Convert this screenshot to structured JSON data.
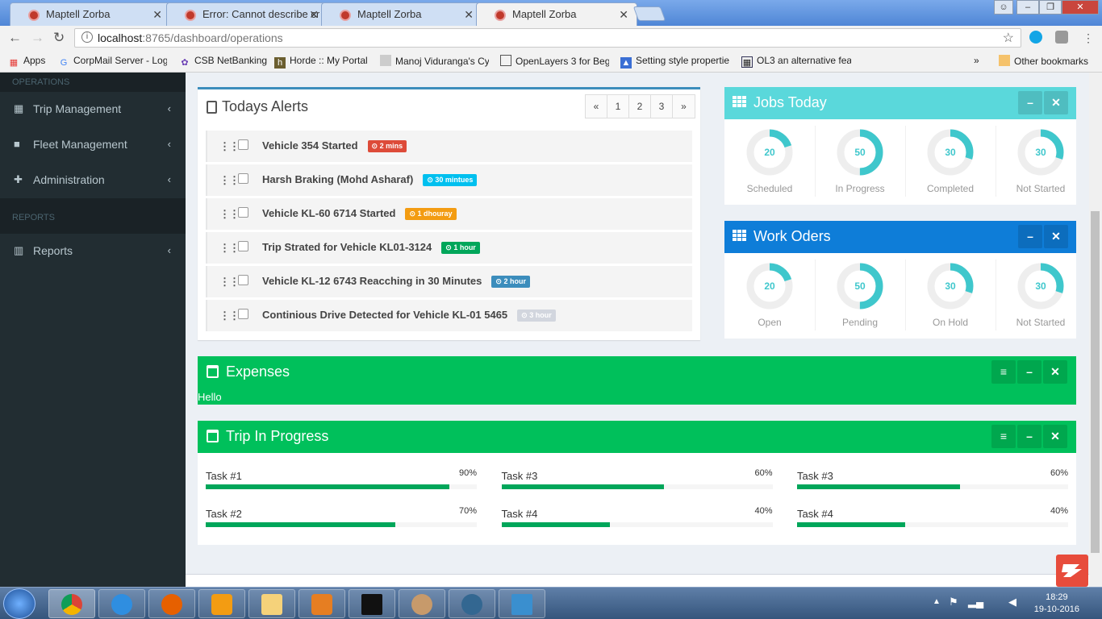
{
  "browser": {
    "tabs": [
      {
        "title": "Maptell Zorba"
      },
      {
        "title": "Error: Cannot describe cr"
      },
      {
        "title": "Maptell Zorba"
      },
      {
        "title": "Maptell Zorba"
      }
    ],
    "url_host": "localhost",
    "url_rest": ":8765/dashboard/operations",
    "bookmarks": [
      "Apps",
      "CorpMail Server - Log",
      "CSB NetBanking",
      "Horde :: My Portal",
      "Manoj Viduranga's Cy",
      "OpenLayers 3 for Beg",
      "Setting style propertie",
      "OL3 an alternative fea",
      "Other bookmarks"
    ]
  },
  "sidebar": {
    "operations_header": "OPERATIONS",
    "reports_header": "REPORTS",
    "items": [
      {
        "label": "Trip Management",
        "icon": "grid-icon"
      },
      {
        "label": "Fleet Management",
        "icon": "bus-icon"
      },
      {
        "label": "Administration",
        "icon": "puzzle-icon"
      },
      {
        "label": "Reports",
        "icon": "bar-chart-icon"
      }
    ]
  },
  "alerts": {
    "title": "Todays Alerts",
    "pager": [
      "«",
      "1",
      "2",
      "3",
      "»"
    ],
    "items": [
      {
        "text": "Vehicle 354 Started",
        "badge": "2 mins",
        "color": "#dd4b39"
      },
      {
        "text": "Harsh Braking (Mohd Asharaf)",
        "badge": "30 mintues",
        "color": "#00c0ef"
      },
      {
        "text": "Vehicle KL-60 6714 Started",
        "badge": "1 dhouray",
        "color": "#f39c12"
      },
      {
        "text": "Trip Strated for Vehicle KL01-3124",
        "badge": "1 hour",
        "color": "#00a65a"
      },
      {
        "text": "Vehicle KL-12 6743 Reacching in 30 Minutes",
        "badge": "2 hour",
        "color": "#3c8dbc"
      },
      {
        "text": "Continious Drive Detected for Vehicle KL-01 5465",
        "badge": "3 hour",
        "color": "#d2d6de"
      }
    ]
  },
  "jobs_today": {
    "title": "Jobs Today",
    "color": "#5ad8db",
    "items": [
      {
        "value": "20",
        "label": "Scheduled",
        "fraction": 0.2
      },
      {
        "value": "50",
        "label": "In Progress",
        "fraction": 0.5
      },
      {
        "value": "30",
        "label": "Completed",
        "fraction": 0.3
      },
      {
        "value": "30",
        "label": "Not Started",
        "fraction": 0.3
      }
    ]
  },
  "work_orders": {
    "title": "Work Oders",
    "color": "#0e7dd8",
    "items": [
      {
        "value": "20",
        "label": "Open",
        "fraction": 0.2
      },
      {
        "value": "50",
        "label": "Pending",
        "fraction": 0.5
      },
      {
        "value": "30",
        "label": "On Hold",
        "fraction": 0.3
      },
      {
        "value": "30",
        "label": "Not Started",
        "fraction": 0.3
      }
    ]
  },
  "expenses": {
    "title": "Expenses",
    "body": "Hello"
  },
  "trip_in_progress": {
    "title": "Trip In Progress",
    "tasks": [
      {
        "name": "Task #1",
        "pct": "90%",
        "value": 90
      },
      {
        "name": "Task #3",
        "pct": "60%",
        "value": 60
      },
      {
        "name": "Task #3",
        "pct": "60%",
        "value": 60
      },
      {
        "name": "Task #2",
        "pct": "70%",
        "value": 70
      },
      {
        "name": "Task #4",
        "pct": "40%",
        "value": 40
      },
      {
        "name": "Task #4",
        "pct": "40%",
        "value": 40
      }
    ]
  },
  "taskbar": {
    "time": "18:29",
    "date": "19-10-2016"
  },
  "colors": {
    "accent_green": "#00c05b",
    "progress": "#00a65a",
    "donut": "#3fc7cc",
    "sidebar": "#222d32"
  }
}
